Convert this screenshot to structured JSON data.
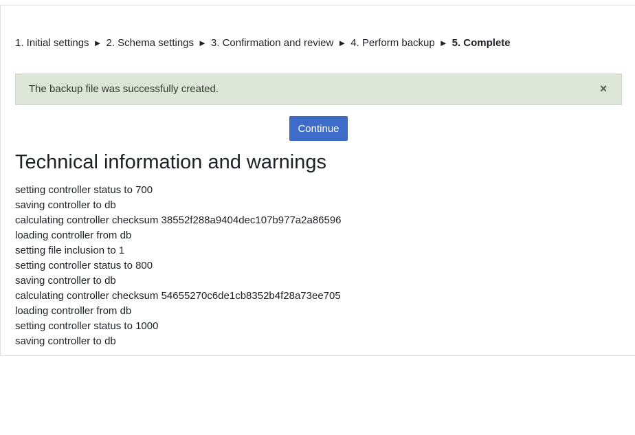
{
  "progress": {
    "steps": [
      "1. Initial settings",
      "2. Schema settings",
      "3. Confirmation and review",
      "4. Perform backup",
      "5. Complete"
    ],
    "separator": "►"
  },
  "alert": {
    "message": "The backup file was successfully created.",
    "close_glyph": "×"
  },
  "buttons": {
    "continue_label": "Continue"
  },
  "section": {
    "title": "Technical information and warnings"
  },
  "log": [
    "setting controller status to 700",
    "saving controller to db",
    "calculating controller checksum 38552f288a9404dec107b977a2a86596",
    "loading controller from db",
    "setting file inclusion to 1",
    "setting controller status to 800",
    "saving controller to db",
    "calculating controller checksum 54655270c6de1cb8352b4f28a73ee705",
    "loading controller from db",
    "setting controller status to 1000",
    "saving controller to db"
  ],
  "colors": {
    "alert_bg": "#dde4d8",
    "button_bg": "#3d6dc8"
  }
}
